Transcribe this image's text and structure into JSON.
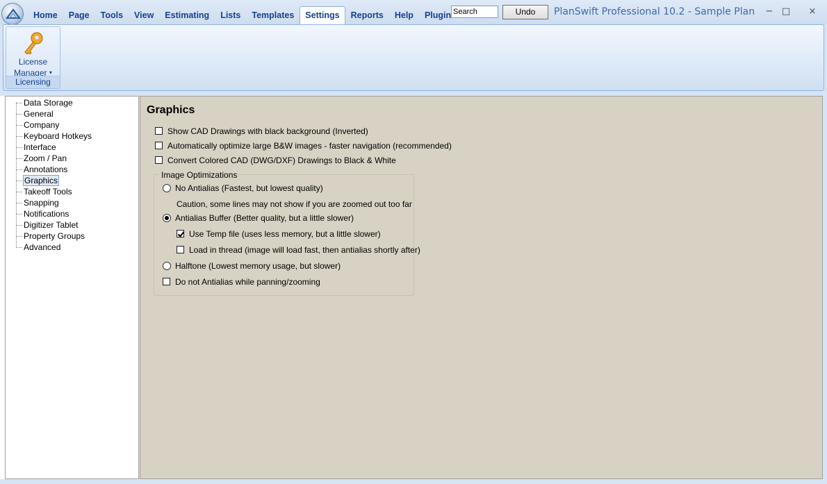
{
  "window": {
    "title": "PlanSwift Professional 10.2 - Sample Plan",
    "minimize_glyph": "−",
    "maximize_glyph": "□",
    "close_glyph": "×"
  },
  "menu": {
    "items": [
      "Home",
      "Page",
      "Tools",
      "View",
      "Estimating",
      "Lists",
      "Templates",
      "Settings",
      "Reports",
      "Help",
      "Plugins"
    ],
    "active": "Settings"
  },
  "search": {
    "placeholder": "Search",
    "value": "Search"
  },
  "undo": {
    "label": "Undo"
  },
  "ribbon": {
    "license_manager_line1": "License",
    "license_manager_line2": "Manager",
    "dropdown_glyph": "▾",
    "group_caption": "Licensing",
    "icon": "key-icon"
  },
  "tree": {
    "items": [
      "Data Storage",
      "General",
      "Company",
      "Keyboard Hotkeys",
      "Interface",
      "Zoom / Pan",
      "Annotations",
      "Graphics",
      "Takeoff Tools",
      "Snapping",
      "Notifications",
      "Digitizer Tablet",
      "Property Groups",
      "Advanced"
    ],
    "selected": "Graphics"
  },
  "graphics": {
    "title": "Graphics",
    "show_cad_black": {
      "label": "Show CAD Drawings with black background (Inverted)",
      "checked": false
    },
    "auto_optimize": {
      "label": "Automatically optimize large B&W images - faster navigation (recommended)",
      "checked": false
    },
    "convert_colored": {
      "label": "Convert Colored CAD (DWG/DXF) Drawings to Black & White",
      "checked": false
    },
    "image_opt": {
      "title": "Image Optimizations",
      "no_antialias": {
        "label": "No Antialias (Fastest, but lowest quality)",
        "checked": false
      },
      "caution": "Caution, some lines may not show if you are zoomed out too far",
      "antialias_buffer": {
        "label": "Antialias Buffer (Better quality, but a little slower)",
        "checked": true
      },
      "use_temp_file": {
        "label": "Use Temp file (uses less memory, but a little slower)",
        "checked": true
      },
      "load_in_thread": {
        "label": "Load in thread (image will load fast, then antialias shortly after)",
        "checked": false
      },
      "halftone": {
        "label": "Halftone (Lowest memory usage, but slower)",
        "checked": false
      },
      "no_antialias_panning": {
        "label": "Do not Antialias while panning/zooming",
        "checked": false
      }
    }
  },
  "colors": {
    "menu_text": "#15428b",
    "content_bg": "#d8d2c4",
    "ribbon_bg": "#dde9f7",
    "key_icon": "#f0a830"
  }
}
